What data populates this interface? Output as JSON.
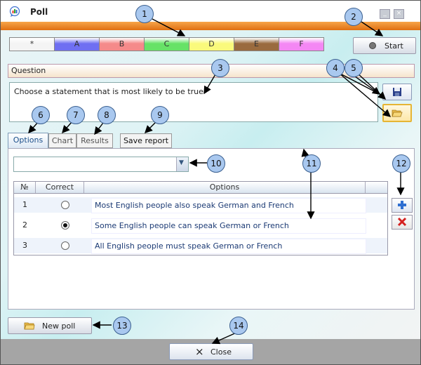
{
  "window": {
    "title": "Poll",
    "minimize_glyph": "_",
    "close_glyph": "×"
  },
  "answer_tabs": [
    {
      "label": "*",
      "color": "#f4f4f4"
    },
    {
      "label": "A",
      "color": "#6f6ff2"
    },
    {
      "label": "B",
      "color": "#f58a8a"
    },
    {
      "label": "C",
      "color": "#67e267"
    },
    {
      "label": "D",
      "color": "#fafa7c"
    },
    {
      "label": "E",
      "color": "#9a6b3e"
    },
    {
      "label": "F",
      "color": "#f487f4"
    }
  ],
  "start_button": {
    "label": "Start"
  },
  "question": {
    "header": "Question",
    "text": "Choose a statement that is most likely to be true"
  },
  "tabs": {
    "options": "Options",
    "chart": "Chart",
    "results": "Results",
    "save_report": "Save report"
  },
  "grid": {
    "headers": {
      "number": "№",
      "correct": "Correct",
      "options": "Options"
    },
    "rows": [
      {
        "number": "1",
        "correct": false,
        "text": "Most English people also speak German and French"
      },
      {
        "number": "2",
        "correct": true,
        "text": "Some English people can speak German or French"
      },
      {
        "number": "3",
        "correct": false,
        "text": "All English people must speak German or French"
      }
    ]
  },
  "new_poll_button": {
    "label": "New poll"
  },
  "close_button": {
    "label": "Close",
    "icon": "×"
  },
  "callouts": [
    "1",
    "2",
    "3",
    "4",
    "5",
    "6",
    "7",
    "8",
    "9",
    "10",
    "11",
    "12",
    "13",
    "14"
  ]
}
